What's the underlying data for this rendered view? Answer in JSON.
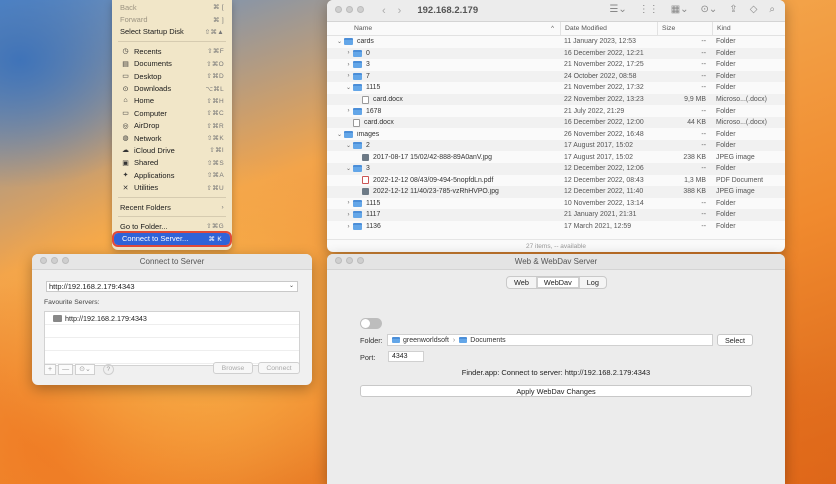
{
  "menu": {
    "items": [
      {
        "label": "Back",
        "shortcut": "⌘ [",
        "icon": "",
        "disabled": true,
        "name": "menu-item-back"
      },
      {
        "label": "Forward",
        "shortcut": "⌘ ]",
        "icon": "",
        "disabled": true,
        "name": "menu-item-forward"
      },
      {
        "label": "Select Startup Disk",
        "shortcut": "⇧⌘▲",
        "icon": "",
        "disabled": false,
        "name": "menu-item-select-startup-disk"
      },
      {
        "sep": true
      },
      {
        "label": "Recents",
        "shortcut": "⇧⌘F",
        "icon": "◷",
        "name": "menu-item-recents"
      },
      {
        "label": "Documents",
        "shortcut": "⇧⌘O",
        "icon": "▤",
        "name": "menu-item-documents"
      },
      {
        "label": "Desktop",
        "shortcut": "⇧⌘D",
        "icon": "▭",
        "name": "menu-item-desktop"
      },
      {
        "label": "Downloads",
        "shortcut": "⌥⌘L",
        "icon": "⊙",
        "name": "menu-item-downloads"
      },
      {
        "label": "Home",
        "shortcut": "⇧⌘H",
        "icon": "⌂",
        "name": "menu-item-home"
      },
      {
        "label": "Computer",
        "shortcut": "⇧⌘C",
        "icon": "▭",
        "name": "menu-item-computer"
      },
      {
        "label": "AirDrop",
        "shortcut": "⇧⌘R",
        "icon": "◎",
        "name": "menu-item-airdrop"
      },
      {
        "label": "Network",
        "shortcut": "⇧⌘K",
        "icon": "◍",
        "name": "menu-item-network"
      },
      {
        "label": "iCloud Drive",
        "shortcut": "⇧⌘I",
        "icon": "☁",
        "name": "menu-item-icloud-drive"
      },
      {
        "label": "Shared",
        "shortcut": "⇧⌘S",
        "icon": "▣",
        "name": "menu-item-shared"
      },
      {
        "label": "Applications",
        "shortcut": "⇧⌘A",
        "icon": "✦",
        "name": "menu-item-applications"
      },
      {
        "label": "Utilities",
        "shortcut": "⇧⌘U",
        "icon": "✕",
        "name": "menu-item-utilities"
      },
      {
        "sep": true
      },
      {
        "label": "Recent Folders",
        "shortcut": "›",
        "icon": "",
        "name": "menu-item-recent-folders"
      },
      {
        "sep": true
      },
      {
        "label": "Go to Folder...",
        "shortcut": "⇧⌘G",
        "icon": "",
        "name": "menu-item-go-to-folder"
      },
      {
        "label": "Connect to Server...",
        "shortcut": "⌘ K",
        "icon": "",
        "selected": true,
        "name": "menu-item-connect-to-server"
      }
    ]
  },
  "finder": {
    "title": "192.168.2.179",
    "columns": {
      "name": "Name",
      "date": "Date Modified",
      "size": "Size",
      "kind": "Kind"
    },
    "rows": [
      {
        "level": 0,
        "disc": "⌄",
        "icon": "folder",
        "name": "cards",
        "date": "11 January 2023, 12:53",
        "size": "--",
        "kind": "Folder"
      },
      {
        "level": 1,
        "disc": "›",
        "icon": "folder",
        "name": "0",
        "date": "16 December 2022, 12:21",
        "size": "--",
        "kind": "Folder"
      },
      {
        "level": 1,
        "disc": "›",
        "icon": "folder",
        "name": "3",
        "date": "21 November 2022, 17:25",
        "size": "--",
        "kind": "Folder"
      },
      {
        "level": 1,
        "disc": "›",
        "icon": "folder",
        "name": "7",
        "date": "24 October 2022, 08:58",
        "size": "--",
        "kind": "Folder"
      },
      {
        "level": 1,
        "disc": "⌄",
        "icon": "folder",
        "name": "1115",
        "date": "21 November 2022, 17:32",
        "size": "--",
        "kind": "Folder"
      },
      {
        "level": 2,
        "disc": "",
        "icon": "doc",
        "name": "card.docx",
        "date": "22 November 2022, 13:23",
        "size": "9,9 MB",
        "kind": "Microso...(.docx)"
      },
      {
        "level": 1,
        "disc": "›",
        "icon": "folder",
        "name": "1678",
        "date": "21 July 2022, 21:29",
        "size": "--",
        "kind": "Folder"
      },
      {
        "level": 1,
        "disc": "",
        "icon": "doc",
        "name": "card.docx",
        "date": "16 December 2022, 12:00",
        "size": "44 KB",
        "kind": "Microso...(.docx)"
      },
      {
        "level": 0,
        "disc": "⌄",
        "icon": "folder",
        "name": "images",
        "date": "26 November 2022, 16:48",
        "size": "--",
        "kind": "Folder"
      },
      {
        "level": 1,
        "disc": "⌄",
        "icon": "folder",
        "name": "2",
        "date": "17 August 2017, 15:02",
        "size": "--",
        "kind": "Folder"
      },
      {
        "level": 2,
        "disc": "",
        "icon": "img",
        "name": "2017-08-17 15/02/42-888-89A0anV.jpg",
        "date": "17 August 2017, 15:02",
        "size": "238 KB",
        "kind": "JPEG image"
      },
      {
        "level": 1,
        "disc": "⌄",
        "icon": "folder",
        "name": "3",
        "date": "12 December 2022, 12:06",
        "size": "--",
        "kind": "Folder"
      },
      {
        "level": 2,
        "disc": "",
        "icon": "pdf",
        "name": "2022-12-12 08/43/09-494-5nopfdLn.pdf",
        "date": "12 December 2022, 08:43",
        "size": "1,3 MB",
        "kind": "PDF Document"
      },
      {
        "level": 2,
        "disc": "",
        "icon": "img",
        "name": "2022-12-12 11/40/23-785-vzRhHVPO.jpg",
        "date": "12 December 2022, 11:40",
        "size": "388 KB",
        "kind": "JPEG image"
      },
      {
        "level": 1,
        "disc": "›",
        "icon": "folder",
        "name": "1115",
        "date": "10 November 2022, 13:14",
        "size": "--",
        "kind": "Folder"
      },
      {
        "level": 1,
        "disc": "›",
        "icon": "folder",
        "name": "1117",
        "date": "21 January 2021, 21:31",
        "size": "--",
        "kind": "Folder"
      },
      {
        "level": 1,
        "disc": "›",
        "icon": "folder",
        "name": "1136",
        "date": "17 March 2021, 12:59",
        "size": "--",
        "kind": "Folder"
      }
    ],
    "status": "27 items, -- available"
  },
  "cts": {
    "title": "Connect to Server",
    "address": "http://192.168.2.179:4343",
    "fav_label": "Favourite Servers:",
    "favourites": [
      "http://192.168.2.179:4343"
    ],
    "add": "+",
    "remove": "—",
    "options": "⊙⌄",
    "help": "?",
    "browse": "Browse",
    "connect": "Connect"
  },
  "webdav": {
    "title": "Web & WebDav Server",
    "tabs": [
      "Web",
      "WebDav",
      "Log"
    ],
    "active_tab": "WebDav",
    "folder_label": "Folder:",
    "path": [
      "greenworldsoft",
      "Documents"
    ],
    "select": "Select",
    "port_label": "Port:",
    "port": "4343",
    "message": "Finder.app: Connect to server: http://192.168.2.179:4343",
    "apply": "Apply WebDav Changes"
  }
}
